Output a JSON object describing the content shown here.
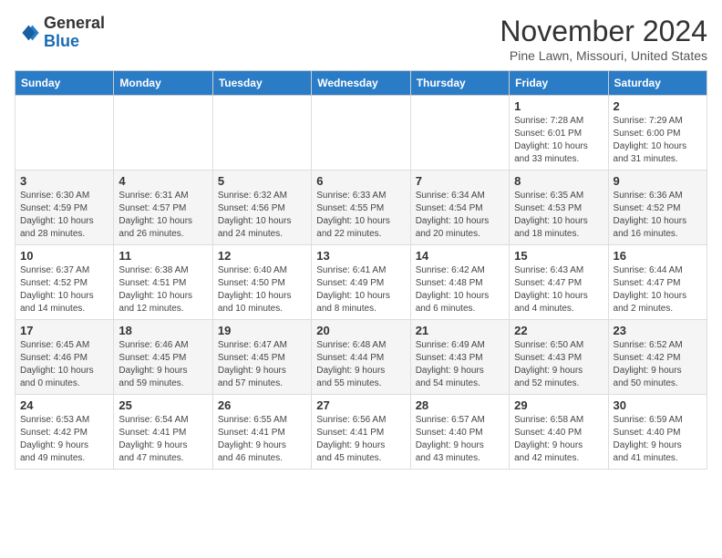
{
  "logo": {
    "general": "General",
    "blue": "Blue"
  },
  "header": {
    "month": "November 2024",
    "location": "Pine Lawn, Missouri, United States"
  },
  "weekdays": [
    "Sunday",
    "Monday",
    "Tuesday",
    "Wednesday",
    "Thursday",
    "Friday",
    "Saturday"
  ],
  "weeks": [
    [
      {
        "day": "",
        "info": ""
      },
      {
        "day": "",
        "info": ""
      },
      {
        "day": "",
        "info": ""
      },
      {
        "day": "",
        "info": ""
      },
      {
        "day": "",
        "info": ""
      },
      {
        "day": "1",
        "info": "Sunrise: 7:28 AM\nSunset: 6:01 PM\nDaylight: 10 hours\nand 33 minutes."
      },
      {
        "day": "2",
        "info": "Sunrise: 7:29 AM\nSunset: 6:00 PM\nDaylight: 10 hours\nand 31 minutes."
      }
    ],
    [
      {
        "day": "3",
        "info": "Sunrise: 6:30 AM\nSunset: 4:59 PM\nDaylight: 10 hours\nand 28 minutes."
      },
      {
        "day": "4",
        "info": "Sunrise: 6:31 AM\nSunset: 4:57 PM\nDaylight: 10 hours\nand 26 minutes."
      },
      {
        "day": "5",
        "info": "Sunrise: 6:32 AM\nSunset: 4:56 PM\nDaylight: 10 hours\nand 24 minutes."
      },
      {
        "day": "6",
        "info": "Sunrise: 6:33 AM\nSunset: 4:55 PM\nDaylight: 10 hours\nand 22 minutes."
      },
      {
        "day": "7",
        "info": "Sunrise: 6:34 AM\nSunset: 4:54 PM\nDaylight: 10 hours\nand 20 minutes."
      },
      {
        "day": "8",
        "info": "Sunrise: 6:35 AM\nSunset: 4:53 PM\nDaylight: 10 hours\nand 18 minutes."
      },
      {
        "day": "9",
        "info": "Sunrise: 6:36 AM\nSunset: 4:52 PM\nDaylight: 10 hours\nand 16 minutes."
      }
    ],
    [
      {
        "day": "10",
        "info": "Sunrise: 6:37 AM\nSunset: 4:52 PM\nDaylight: 10 hours\nand 14 minutes."
      },
      {
        "day": "11",
        "info": "Sunrise: 6:38 AM\nSunset: 4:51 PM\nDaylight: 10 hours\nand 12 minutes."
      },
      {
        "day": "12",
        "info": "Sunrise: 6:40 AM\nSunset: 4:50 PM\nDaylight: 10 hours\nand 10 minutes."
      },
      {
        "day": "13",
        "info": "Sunrise: 6:41 AM\nSunset: 4:49 PM\nDaylight: 10 hours\nand 8 minutes."
      },
      {
        "day": "14",
        "info": "Sunrise: 6:42 AM\nSunset: 4:48 PM\nDaylight: 10 hours\nand 6 minutes."
      },
      {
        "day": "15",
        "info": "Sunrise: 6:43 AM\nSunset: 4:47 PM\nDaylight: 10 hours\nand 4 minutes."
      },
      {
        "day": "16",
        "info": "Sunrise: 6:44 AM\nSunset: 4:47 PM\nDaylight: 10 hours\nand 2 minutes."
      }
    ],
    [
      {
        "day": "17",
        "info": "Sunrise: 6:45 AM\nSunset: 4:46 PM\nDaylight: 10 hours\nand 0 minutes."
      },
      {
        "day": "18",
        "info": "Sunrise: 6:46 AM\nSunset: 4:45 PM\nDaylight: 9 hours\nand 59 minutes."
      },
      {
        "day": "19",
        "info": "Sunrise: 6:47 AM\nSunset: 4:45 PM\nDaylight: 9 hours\nand 57 minutes."
      },
      {
        "day": "20",
        "info": "Sunrise: 6:48 AM\nSunset: 4:44 PM\nDaylight: 9 hours\nand 55 minutes."
      },
      {
        "day": "21",
        "info": "Sunrise: 6:49 AM\nSunset: 4:43 PM\nDaylight: 9 hours\nand 54 minutes."
      },
      {
        "day": "22",
        "info": "Sunrise: 6:50 AM\nSunset: 4:43 PM\nDaylight: 9 hours\nand 52 minutes."
      },
      {
        "day": "23",
        "info": "Sunrise: 6:52 AM\nSunset: 4:42 PM\nDaylight: 9 hours\nand 50 minutes."
      }
    ],
    [
      {
        "day": "24",
        "info": "Sunrise: 6:53 AM\nSunset: 4:42 PM\nDaylight: 9 hours\nand 49 minutes."
      },
      {
        "day": "25",
        "info": "Sunrise: 6:54 AM\nSunset: 4:41 PM\nDaylight: 9 hours\nand 47 minutes."
      },
      {
        "day": "26",
        "info": "Sunrise: 6:55 AM\nSunset: 4:41 PM\nDaylight: 9 hours\nand 46 minutes."
      },
      {
        "day": "27",
        "info": "Sunrise: 6:56 AM\nSunset: 4:41 PM\nDaylight: 9 hours\nand 45 minutes."
      },
      {
        "day": "28",
        "info": "Sunrise: 6:57 AM\nSunset: 4:40 PM\nDaylight: 9 hours\nand 43 minutes."
      },
      {
        "day": "29",
        "info": "Sunrise: 6:58 AM\nSunset: 4:40 PM\nDaylight: 9 hours\nand 42 minutes."
      },
      {
        "day": "30",
        "info": "Sunrise: 6:59 AM\nSunset: 4:40 PM\nDaylight: 9 hours\nand 41 minutes."
      }
    ]
  ]
}
